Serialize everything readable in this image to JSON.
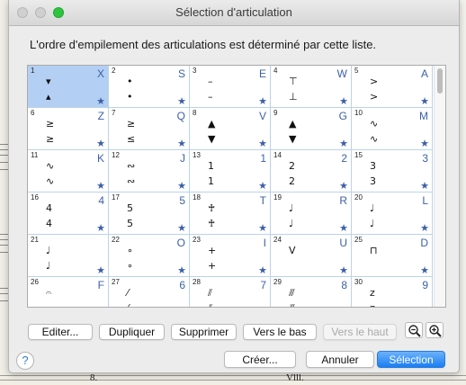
{
  "window": {
    "title": "Sélection d'articulation"
  },
  "description": "L'ordre d'empilement des articulations est déterminé par cette liste.",
  "cells": [
    {
      "num": "1",
      "key": "X",
      "g1": "▾",
      "g2": "▴",
      "selected": true
    },
    {
      "num": "2",
      "key": "S",
      "g1": "•",
      "g2": "•"
    },
    {
      "num": "3",
      "key": "E",
      "g1": "–",
      "g2": "–"
    },
    {
      "num": "4",
      "key": "W",
      "g1": "⊤",
      "g2": "⊥"
    },
    {
      "num": "5",
      "key": "A",
      "g1": ">",
      "g2": ">"
    },
    {
      "num": "6",
      "key": "Z",
      "g1": "≥",
      "g2": "≥"
    },
    {
      "num": "7",
      "key": "Q",
      "g1": "≥",
      "g2": "≤"
    },
    {
      "num": "8",
      "key": "V",
      "g1": "▲",
      "g2": "▼"
    },
    {
      "num": "9",
      "key": "G",
      "g1": "▲",
      "g2": "▼"
    },
    {
      "num": "10",
      "key": "M",
      "g1": "∿",
      "g2": "∿"
    },
    {
      "num": "11",
      "key": "K",
      "g1": "∿",
      "g2": "∿"
    },
    {
      "num": "12",
      "key": "J",
      "g1": "∾",
      "g2": "∾"
    },
    {
      "num": "13",
      "key": "1",
      "g1": "1",
      "g2": "1"
    },
    {
      "num": "14",
      "key": "2",
      "g1": "2",
      "g2": "2"
    },
    {
      "num": "15",
      "key": "3",
      "g1": "3",
      "g2": "3"
    },
    {
      "num": "16",
      "key": "4",
      "g1": "4",
      "g2": "4"
    },
    {
      "num": "17",
      "key": "5",
      "g1": "5",
      "g2": "5"
    },
    {
      "num": "18",
      "key": "T",
      "g1": "♰",
      "g2": "♰"
    },
    {
      "num": "19",
      "key": "R",
      "g1": "♩",
      "g2": "♩"
    },
    {
      "num": "20",
      "key": "L",
      "g1": "♩",
      "g2": "♩"
    },
    {
      "num": "21",
      "key": "",
      "g1": "♩",
      "g2": "♩"
    },
    {
      "num": "22",
      "key": "O",
      "g1": "∘",
      "g2": "∘"
    },
    {
      "num": "23",
      "key": "I",
      "g1": "+",
      "g2": "+"
    },
    {
      "num": "24",
      "key": "U",
      "g1": "V",
      "g2": ""
    },
    {
      "num": "25",
      "key": "D",
      "g1": "⊓",
      "g2": ""
    },
    {
      "num": "26",
      "key": "F",
      "g1": "𝄐",
      "g2": "𝄑"
    },
    {
      "num": "27",
      "key": "6",
      "g1": "⁄",
      "g2": "⁄"
    },
    {
      "num": "28",
      "key": "7",
      "g1": "⫽",
      "g2": "⫽"
    },
    {
      "num": "29",
      "key": "8",
      "g1": "⫻",
      "g2": "⫻"
    },
    {
      "num": "30",
      "key": "9",
      "g1": "z",
      "g2": "z"
    }
  ],
  "star": "★",
  "toolbar": {
    "edit": "Editer...",
    "duplicate": "Dupliquer",
    "delete": "Supprimer",
    "move_down": "Vers le bas",
    "move_up": "Vers le haut"
  },
  "footer": {
    "create": "Créer...",
    "cancel": "Annuler",
    "select": "Sélection",
    "help": "?"
  },
  "background": {
    "text_left": "8.",
    "text_right": "Vlll."
  }
}
